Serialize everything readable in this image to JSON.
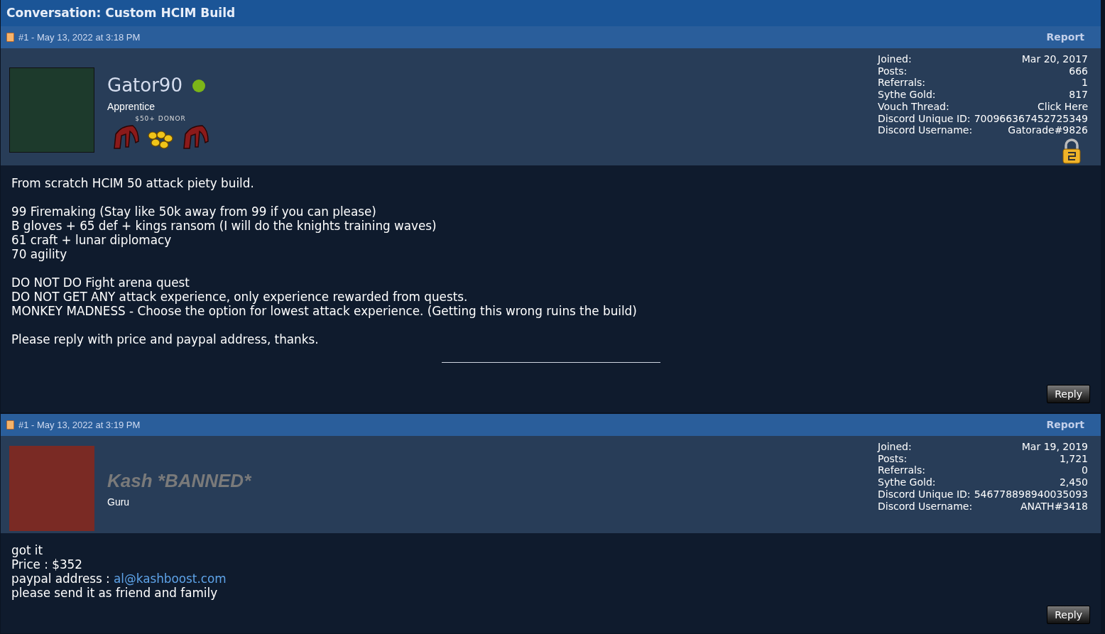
{
  "title": "Conversation: Custom HCIM Build",
  "posts": [
    {
      "number": "#1 - May 13, 2022 at 3:18 PM",
      "report": "Report",
      "username": "Gator90",
      "banned": false,
      "online": true,
      "rank": "Apprentice",
      "badge": "$50+ DONOR",
      "security_icon": true,
      "stats": [
        {
          "label": "Joined:",
          "value": "Mar 20, 2017"
        },
        {
          "label": "Posts:",
          "value": "666"
        },
        {
          "label": "Referrals:",
          "value": "1"
        },
        {
          "label": "Sythe Gold:",
          "value": "817"
        },
        {
          "label": "Vouch Thread:",
          "link": "Click Here"
        },
        {
          "label": "Discord Unique ID:",
          "value": "700966367452725349"
        },
        {
          "label": "Discord Username:",
          "value": "Gatorade#9826"
        }
      ],
      "paragraphs": [
        [
          {
            "text": "From scratch HCIM 50 attack piety build."
          }
        ],
        [
          {
            "text": "99 Firemaking (Stay like 50k away from 99 if you can please)"
          },
          {
            "text": "B gloves + 65 def + kings ransom (I will do the knights training waves)"
          },
          {
            "text": "61 craft + lunar diplomacy"
          },
          {
            "text": "70 agility"
          }
        ],
        [
          {
            "text": "DO NOT DO Fight arena quest"
          },
          {
            "text": "DO NOT GET ANY attack experience, only experience rewarded from quests."
          },
          {
            "text": "MONKEY MADNESS - Choose the option for lowest attack experience. (Getting this wrong ruins the build)"
          }
        ],
        [
          {
            "text": "Please reply with price and paypal address, thanks."
          }
        ]
      ],
      "signature_rule": true,
      "reply": "Reply"
    },
    {
      "number": "#1 - May 13, 2022 at 3:19 PM",
      "report": "Report",
      "username": "Kash *BANNED*",
      "banned": true,
      "online": false,
      "rank": "Guru",
      "security_icon": false,
      "stats": [
        {
          "label": "Joined:",
          "value": "Mar 19, 2019"
        },
        {
          "label": "Posts:",
          "value": "1,721"
        },
        {
          "label": "Referrals:",
          "value": "0"
        },
        {
          "label": "Sythe Gold:",
          "value": "2,450"
        },
        {
          "label": "Discord Unique ID:",
          "value": "546778898940035093"
        },
        {
          "label": "Discord Username:",
          "value": "ANATH#3418"
        }
      ],
      "paragraphs": [
        [
          {
            "text": "got it"
          },
          {
            "text": "Price : $352"
          },
          {
            "text": "paypal address : ",
            "link": "al@kashboost.com"
          },
          {
            "text": "please send it as friend and family"
          }
        ]
      ],
      "signature_rule": false,
      "reply": "Reply"
    }
  ]
}
